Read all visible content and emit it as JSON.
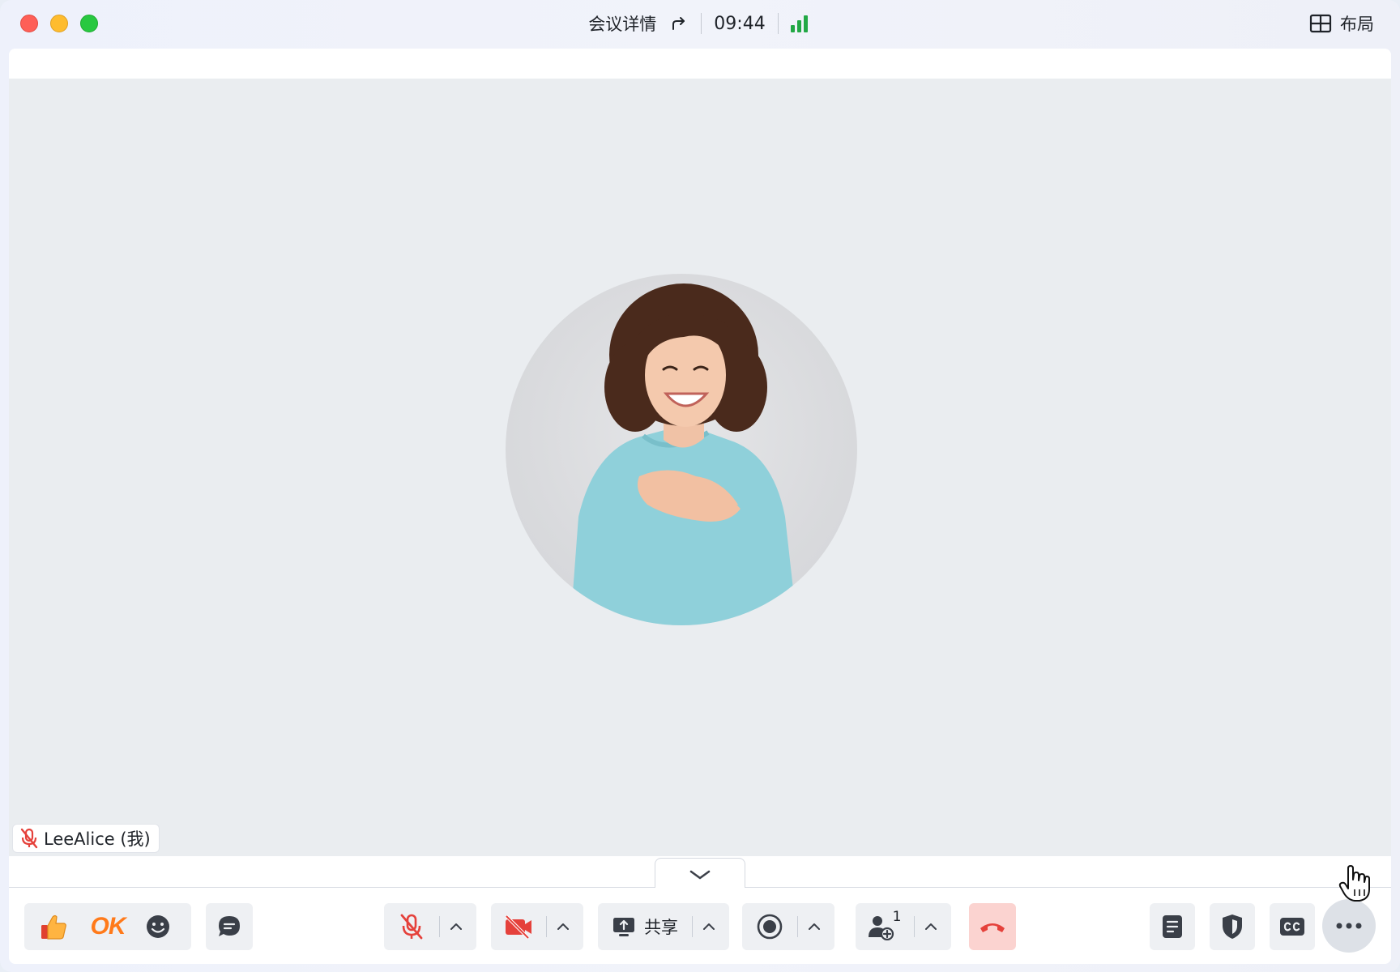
{
  "titlebar": {
    "title": "会议详情",
    "time": "09:44",
    "layout_label": "布局"
  },
  "participant": {
    "name": "LeeAlice (我)",
    "muted": true
  },
  "toolbar": {
    "reaction_ok": "OK",
    "share_label": "共享",
    "participants_count": "1"
  },
  "colors": {
    "signal": "#22a845",
    "muted_red": "#e5413b",
    "hangup_bg": "#fbd3d0",
    "hangup_icon": "#e5413b",
    "ok_orange": "#ff7a1a"
  }
}
